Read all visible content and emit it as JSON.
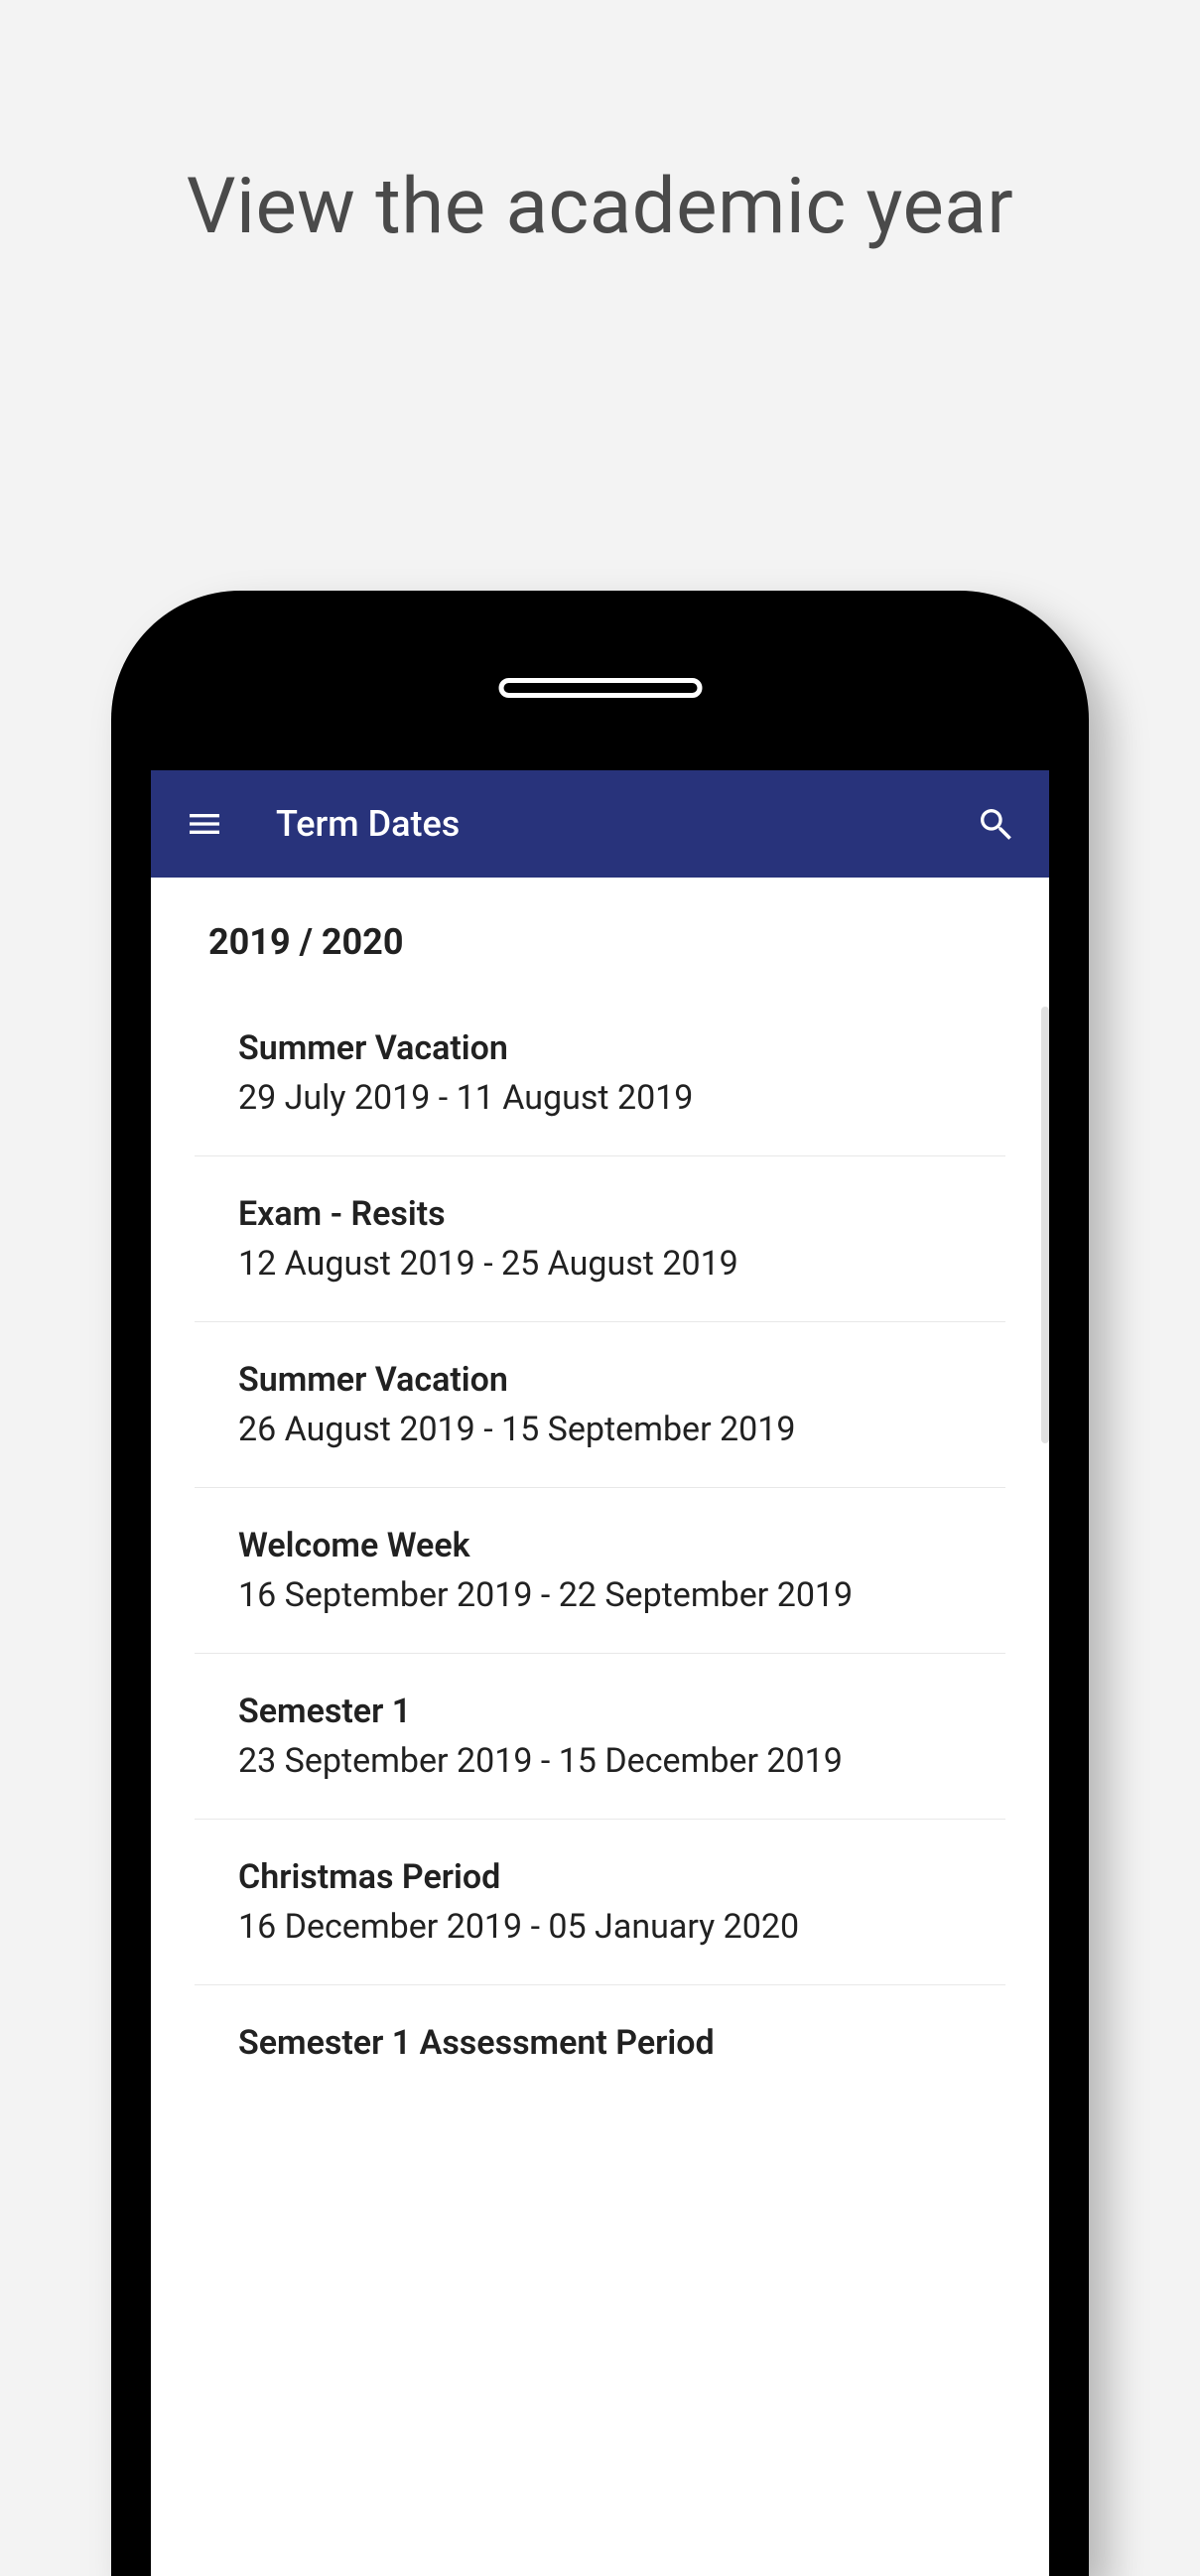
{
  "page": {
    "heading": "View the academic year"
  },
  "appbar": {
    "title": "Term Dates"
  },
  "year_label": "2019 / 2020",
  "terms": [
    {
      "title": "Summer Vacation",
      "dates": "29 July 2019 - 11 August 2019"
    },
    {
      "title": "Exam - Resits",
      "dates": "12 August 2019 - 25 August 2019"
    },
    {
      "title": "Summer Vacation",
      "dates": "26 August 2019 - 15 September 2019"
    },
    {
      "title": "Welcome Week",
      "dates": "16 September 2019 - 22 September 2019"
    },
    {
      "title": "Semester 1",
      "dates": "23 September 2019 - 15 December 2019"
    },
    {
      "title": "Christmas Period",
      "dates": "16 December 2019 - 05 January 2020"
    },
    {
      "title": "Semester 1 Assessment Period",
      "dates": ""
    }
  ]
}
